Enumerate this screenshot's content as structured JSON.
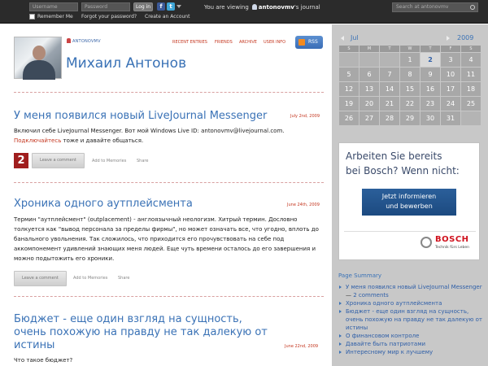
{
  "topbar": {
    "username_placeholder": "Username",
    "password_placeholder": "Password",
    "login_label": "Log in",
    "remember_label": "Remember Me",
    "forgot_label": "Forgot your password?",
    "create_label": "Create an Account",
    "viewing_prefix": "You are viewing",
    "viewing_user": "antonovmv",
    "viewing_suffix": "'s journal",
    "search_placeholder": "Search at antonovmv"
  },
  "header": {
    "username": "ANTONOVMV",
    "journal_title": "Михаил Антонов",
    "nav": [
      "RECENT ENTRIES",
      "FRIENDS",
      "ARCHIVE",
      "USER INFO"
    ],
    "rss_label": "RSS"
  },
  "posts": [
    {
      "title": "У меня появился новый LiveJournal Messenger",
      "date": "July 2nd, 2009",
      "body_line1": "Включил себе LiveJournal Messenger. Вот мой Windows Live ID: antonovmv@livejournal.com.",
      "body_link": "Подключайтесь",
      "body_line2_rest": " тоже и давайте общаться.",
      "comment_count": "2",
      "leave_comment": "Leave a comment",
      "add_memories": "Add to Memories",
      "share": "Share"
    },
    {
      "title": "Хроника одного аутплейсмента",
      "date": "June 24th, 2009",
      "body": "Термин \"аутплейсмент\" (outplacement) - англоязычный неологизм. Хитрый термин. Дословно толкуется как \"вывод персонала за пределы фирмы\", но может означать все, что угодно, вплоть до банального увольнения. Так сложилось, что приходится его прочувствовать на себе под аккомпонемент удивлений знающих меня людей. Еще чуть времени осталось до его завершения и можно подытожить его хроники.",
      "leave_comment": "Leave a comment",
      "add_memories": "Add to Memories",
      "share": "Share"
    },
    {
      "title_line1": "Бюджет - еще один взгляд на сущность,",
      "title_line2": "очень похожую на правду не так далекую от",
      "title_line3": "истины",
      "date": "June 22nd, 2009",
      "body": "Что такое бюджет?"
    }
  ],
  "calendar": {
    "month": "Jul",
    "year": "2009",
    "weekdays": [
      "S",
      "M",
      "T",
      "W",
      "T",
      "F",
      "S"
    ],
    "days": [
      "",
      "",
      "",
      "1",
      "2",
      "3",
      "4",
      "5",
      "6",
      "7",
      "8",
      "9",
      "10",
      "11",
      "12",
      "13",
      "14",
      "15",
      "16",
      "17",
      "18",
      "19",
      "20",
      "21",
      "22",
      "23",
      "24",
      "25",
      "26",
      "27",
      "28",
      "29",
      "30",
      "31",
      ""
    ],
    "linked_days": [
      "2"
    ]
  },
  "ad": {
    "headline_line1": "Arbeiten Sie bereits",
    "headline_line2": "bei Bosch? Wenn nicht:",
    "button_line1": "Jetzt informieren",
    "button_line2": "und bewerben",
    "logo": "BOSCH",
    "tagline": "Technik fürs Leben"
  },
  "summary": {
    "title": "Page Summary",
    "items": [
      "У меня появился новый LiveJournal Messenger",
      "Хроника одного аутплейсмента",
      "Бюджет - еще один взгляд на сущность, очень похожую на правду не так далекую от истины",
      "О финансовом контроле",
      "Давайте быть патриотами",
      "Интересному мир к лучшему"
    ],
    "first_sep": " — ",
    "first_comments": "2 comments"
  }
}
